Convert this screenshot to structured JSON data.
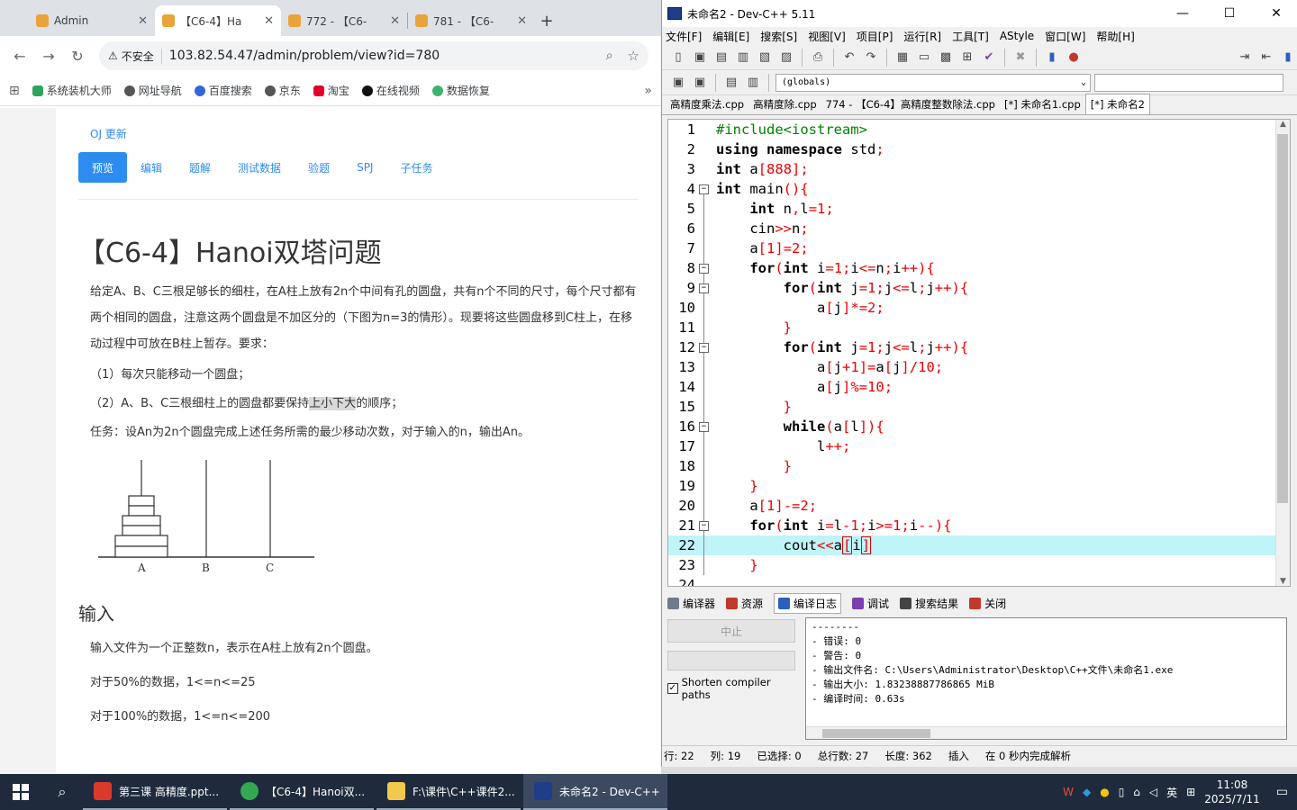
{
  "browser": {
    "tabs": [
      {
        "label": "Admin",
        "active": false
      },
      {
        "label": "【C6-4】Ha",
        "active": true
      },
      {
        "label": "772 - 【C6-",
        "active": false
      },
      {
        "label": "781 - 【C6-",
        "active": false
      }
    ],
    "insecure_label": "不安全",
    "url": "103.82.54.47/admin/problem/view?id=780",
    "bookmarks": [
      "系统装机大师",
      "网址导航",
      "百度搜索",
      "京东",
      "淘宝",
      "在线视频",
      "数据恢复"
    ]
  },
  "problem": {
    "oj_update": "OJ 更新",
    "tabs": [
      "预览",
      "编辑",
      "题解",
      "测试数据",
      "验题",
      "SPJ",
      "子任务"
    ],
    "title": "【C6-4】Hanoi双塔问题",
    "desc": "给定A、B、C三根足够长的细柱，在A柱上放有2n个中间有孔的圆盘，共有n个不同的尺寸，每个尺寸都有两个相同的圆盘，注意这两个圆盘是不加区分的（下图为n=3的情形）。现要将这些圆盘移到C柱上，在移动过程中可放在B柱上暂存。要求：",
    "req1": "（1）每次只能移动一个圆盘；",
    "req2_pre": "（2）A、B、C三根细柱上的圆盘都要保持",
    "req2_hl": "上小下大",
    "req2_post": "的顺序；",
    "task": "任务：设An为2n个圆盘完成上述任务所需的最少移动次数，对于输入的n，输出An。",
    "pillars": [
      "A",
      "B",
      "C"
    ],
    "input_heading": "输入",
    "input_text": "输入文件为一个正整数n，表示在A柱上放有2n个圆盘。",
    "data50": "对于50%的数据，1<=n<=25",
    "data100": "对于100%的数据，1<=n<=200"
  },
  "devcpp": {
    "title": "未命名2 - Dev-C++ 5.11",
    "menu": [
      "文件[F]",
      "编辑[E]",
      "搜索[S]",
      "视图[V]",
      "项目[P]",
      "运行[R]",
      "工具[T]",
      "AStyle",
      "窗口[W]",
      "帮助[H]"
    ],
    "globals": "(globals)",
    "file_tabs": [
      {
        "label": "高精度乘法.cpp",
        "active": false
      },
      {
        "label": "高精度除.cpp",
        "active": false
      },
      {
        "label": "774 - 【C6-4】高精度整数除法.cpp",
        "active": false
      },
      {
        "label": "[*] 未命名1.cpp",
        "active": false
      },
      {
        "label": "[*] 未命名2",
        "active": true
      }
    ],
    "code_lines": [
      "#include<iostream>",
      "using namespace std;",
      "int a[888];",
      "int main(){",
      "    int n,l=1;",
      "    cin>>n;",
      "    a[1]=2;",
      "    for(int i=1;i<=n;i++){",
      "        for(int j=1;j<=l;j++){",
      "            a[j]*=2;",
      "        }",
      "        for(int j=1;j<=l;j++){",
      "            a[j+1]=a[j]/10;",
      "            a[j]%=10;",
      "        }",
      "        while(a[l]){",
      "            l++;",
      "        }",
      "    }",
      "    a[1]-=2;",
      "    for(int i=l-1;i>=1;i--){",
      "        cout<<a[i]",
      "    }",
      "24"
    ],
    "bottom_tabs": [
      "编译器",
      "资源",
      "编译日志",
      "调试",
      "搜索结果",
      "关闭"
    ],
    "stop_label": "中止",
    "shorten_label": "Shorten compiler paths",
    "log_lines": [
      "--------",
      "- 错误: 0",
      "- 警告: 0",
      "- 输出文件名: C:\\Users\\Administrator\\Desktop\\C++文件\\未命名1.exe",
      "- 输出大小: 1.83238887786865 MiB",
      "- 编译时间: 0.63s"
    ],
    "status": {
      "line_label": "行:",
      "line": "22",
      "col_label": "列:",
      "col": "19",
      "sel_label": "已选择:",
      "sel": "0",
      "total_label": "总行数:",
      "total": "27",
      "len_label": "长度:",
      "len": "362",
      "mode": "插入",
      "parse": "在 0 秒内完成解析"
    }
  },
  "taskbar": {
    "apps": [
      {
        "label": "第三课 高精度.ppt...",
        "color": "#d93a2b"
      },
      {
        "label": "【C6-4】Hanoi双...",
        "color": "#34a853"
      },
      {
        "label": "F:\\课件\\C++课件2...",
        "color": "#f2c94c"
      },
      {
        "label": "未命名2 - Dev-C++",
        "color": "#1f3c88"
      }
    ],
    "ime": "英",
    "time": "11:08",
    "date": "2025/7/11"
  },
  "colors": {
    "accent": "#2d8cf0",
    "devcpp_keyword": "#000000",
    "devcpp_symbol": "#e00000",
    "current_line": "#bff4f8"
  }
}
